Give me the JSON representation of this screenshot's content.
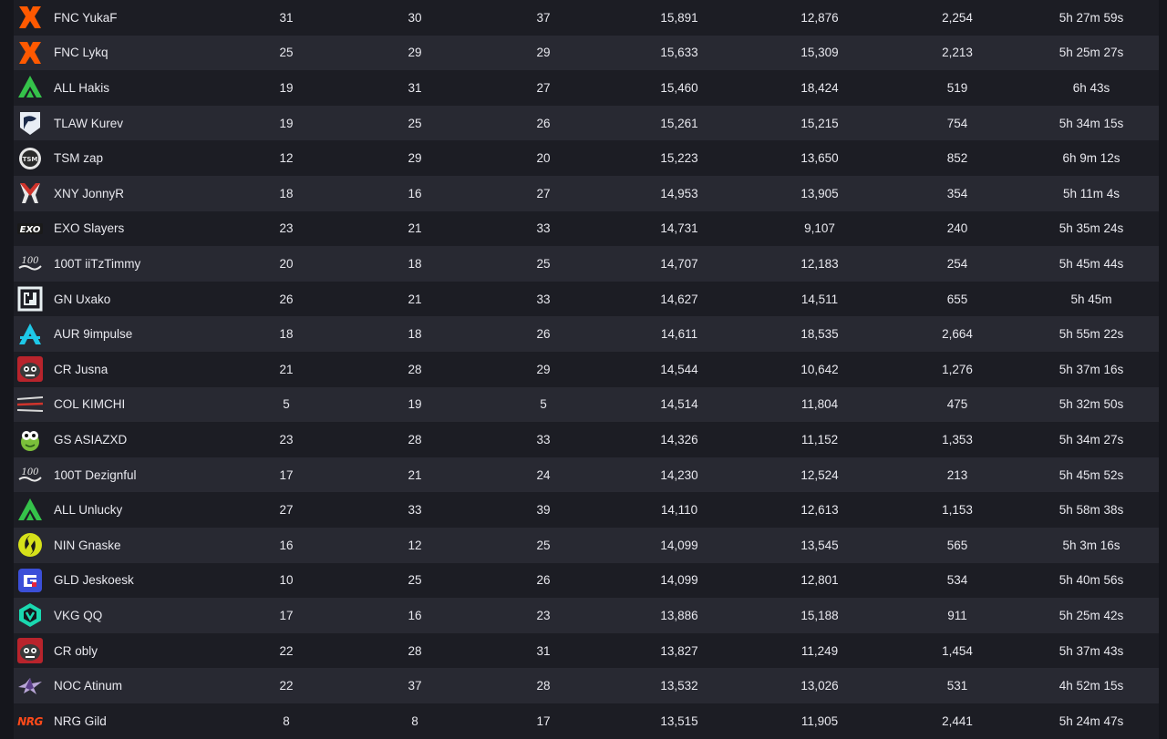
{
  "players": [
    {
      "name": "FNC YukaF",
      "team": "FNC",
      "logo": "fnatic-logo",
      "v": [
        "31",
        "30",
        "37",
        "15,891",
        "12,876",
        "2,254",
        "5h 27m 59s"
      ]
    },
    {
      "name": "FNC Lykq",
      "team": "FNC",
      "logo": "fnatic-logo",
      "v": [
        "25",
        "29",
        "29",
        "15,633",
        "15,309",
        "2,213",
        "5h 25m 27s"
      ]
    },
    {
      "name": "ALL Hakis",
      "team": "ALL",
      "logo": "alliance-logo",
      "v": [
        "19",
        "31",
        "27",
        "15,460",
        "18,424",
        "519",
        "6h 43s"
      ]
    },
    {
      "name": "TLAW Kurev",
      "team": "TLAW",
      "logo": "liquid-logo",
      "v": [
        "19",
        "25",
        "26",
        "15,261",
        "15,215",
        "754",
        "5h 34m 15s"
      ]
    },
    {
      "name": "TSM zap",
      "team": "TSM",
      "logo": "tsm-logo",
      "v": [
        "12",
        "29",
        "20",
        "15,223",
        "13,650",
        "852",
        "6h 9m 12s"
      ]
    },
    {
      "name": "XNY JonnyR",
      "team": "XNY",
      "logo": "xny-logo",
      "v": [
        "18",
        "16",
        "27",
        "14,953",
        "13,905",
        "354",
        "5h 11m 4s"
      ]
    },
    {
      "name": "EXO Slayers",
      "team": "EXO",
      "logo": "exo-logo",
      "v": [
        "23",
        "21",
        "33",
        "14,731",
        "9,107",
        "240",
        "5h 35m 24s"
      ]
    },
    {
      "name": "100T iiTzTimmy",
      "team": "100T",
      "logo": "100t-logo",
      "v": [
        "20",
        "18",
        "25",
        "14,707",
        "12,183",
        "254",
        "5h 45m 44s"
      ]
    },
    {
      "name": "GN Uxako",
      "team": "GN",
      "logo": "gn-logo",
      "v": [
        "26",
        "21",
        "33",
        "14,627",
        "14,511",
        "655",
        "5h 45m"
      ]
    },
    {
      "name": "AUR 9impulse",
      "team": "AUR",
      "logo": "aurora-logo",
      "v": [
        "18",
        "18",
        "26",
        "14,611",
        "18,535",
        "2,664",
        "5h 55m 22s"
      ]
    },
    {
      "name": "CR Jusna",
      "team": "CR",
      "logo": "cr-logo",
      "v": [
        "21",
        "28",
        "29",
        "14,544",
        "10,642",
        "1,276",
        "5h 37m 16s"
      ]
    },
    {
      "name": "COL KIMCHI",
      "team": "COL",
      "logo": "col-logo",
      "v": [
        "5",
        "19",
        "5",
        "14,514",
        "11,804",
        "475",
        "5h 32m 50s"
      ]
    },
    {
      "name": "GS ASIAZXD",
      "team": "GS",
      "logo": "gs-logo",
      "v": [
        "23",
        "28",
        "33",
        "14,326",
        "11,152",
        "1,353",
        "5h 34m 27s"
      ]
    },
    {
      "name": "100T Dezignful",
      "team": "100T",
      "logo": "100t-logo",
      "v": [
        "17",
        "21",
        "24",
        "14,230",
        "12,524",
        "213",
        "5h 45m 52s"
      ]
    },
    {
      "name": "ALL Unlucky",
      "team": "ALL",
      "logo": "alliance-logo",
      "v": [
        "27",
        "33",
        "39",
        "14,110",
        "12,613",
        "1,153",
        "5h 58m 38s"
      ]
    },
    {
      "name": "NIN Gnaske",
      "team": "NIN",
      "logo": "ninjas-logo",
      "v": [
        "16",
        "12",
        "25",
        "14,099",
        "13,545",
        "565",
        "5h 3m 16s"
      ]
    },
    {
      "name": "GLD Jeskoesk",
      "team": "GLD",
      "logo": "gld-logo",
      "v": [
        "10",
        "25",
        "26",
        "14,099",
        "12,801",
        "534",
        "5h 40m 56s"
      ]
    },
    {
      "name": "VKG QQ",
      "team": "VKG",
      "logo": "vkg-logo",
      "v": [
        "17",
        "16",
        "23",
        "13,886",
        "15,188",
        "911",
        "5h 25m 42s"
      ]
    },
    {
      "name": "CR obly",
      "team": "CR",
      "logo": "cr-logo",
      "v": [
        "22",
        "28",
        "31",
        "13,827",
        "11,249",
        "1,454",
        "5h 37m 43s"
      ]
    },
    {
      "name": "NOC Atinum",
      "team": "NOC",
      "logo": "noc-logo",
      "v": [
        "22",
        "37",
        "28",
        "13,532",
        "13,026",
        "531",
        "4h 52m 15s"
      ]
    },
    {
      "name": "NRG Gild",
      "team": "NRG",
      "logo": "nrg-logo",
      "v": [
        "8",
        "8",
        "17",
        "13,515",
        "11,905",
        "2,441",
        "5h 24m 47s"
      ]
    }
  ],
  "text_100t": "100",
  "text_nrg": "NRG",
  "text_exo": "EXO"
}
